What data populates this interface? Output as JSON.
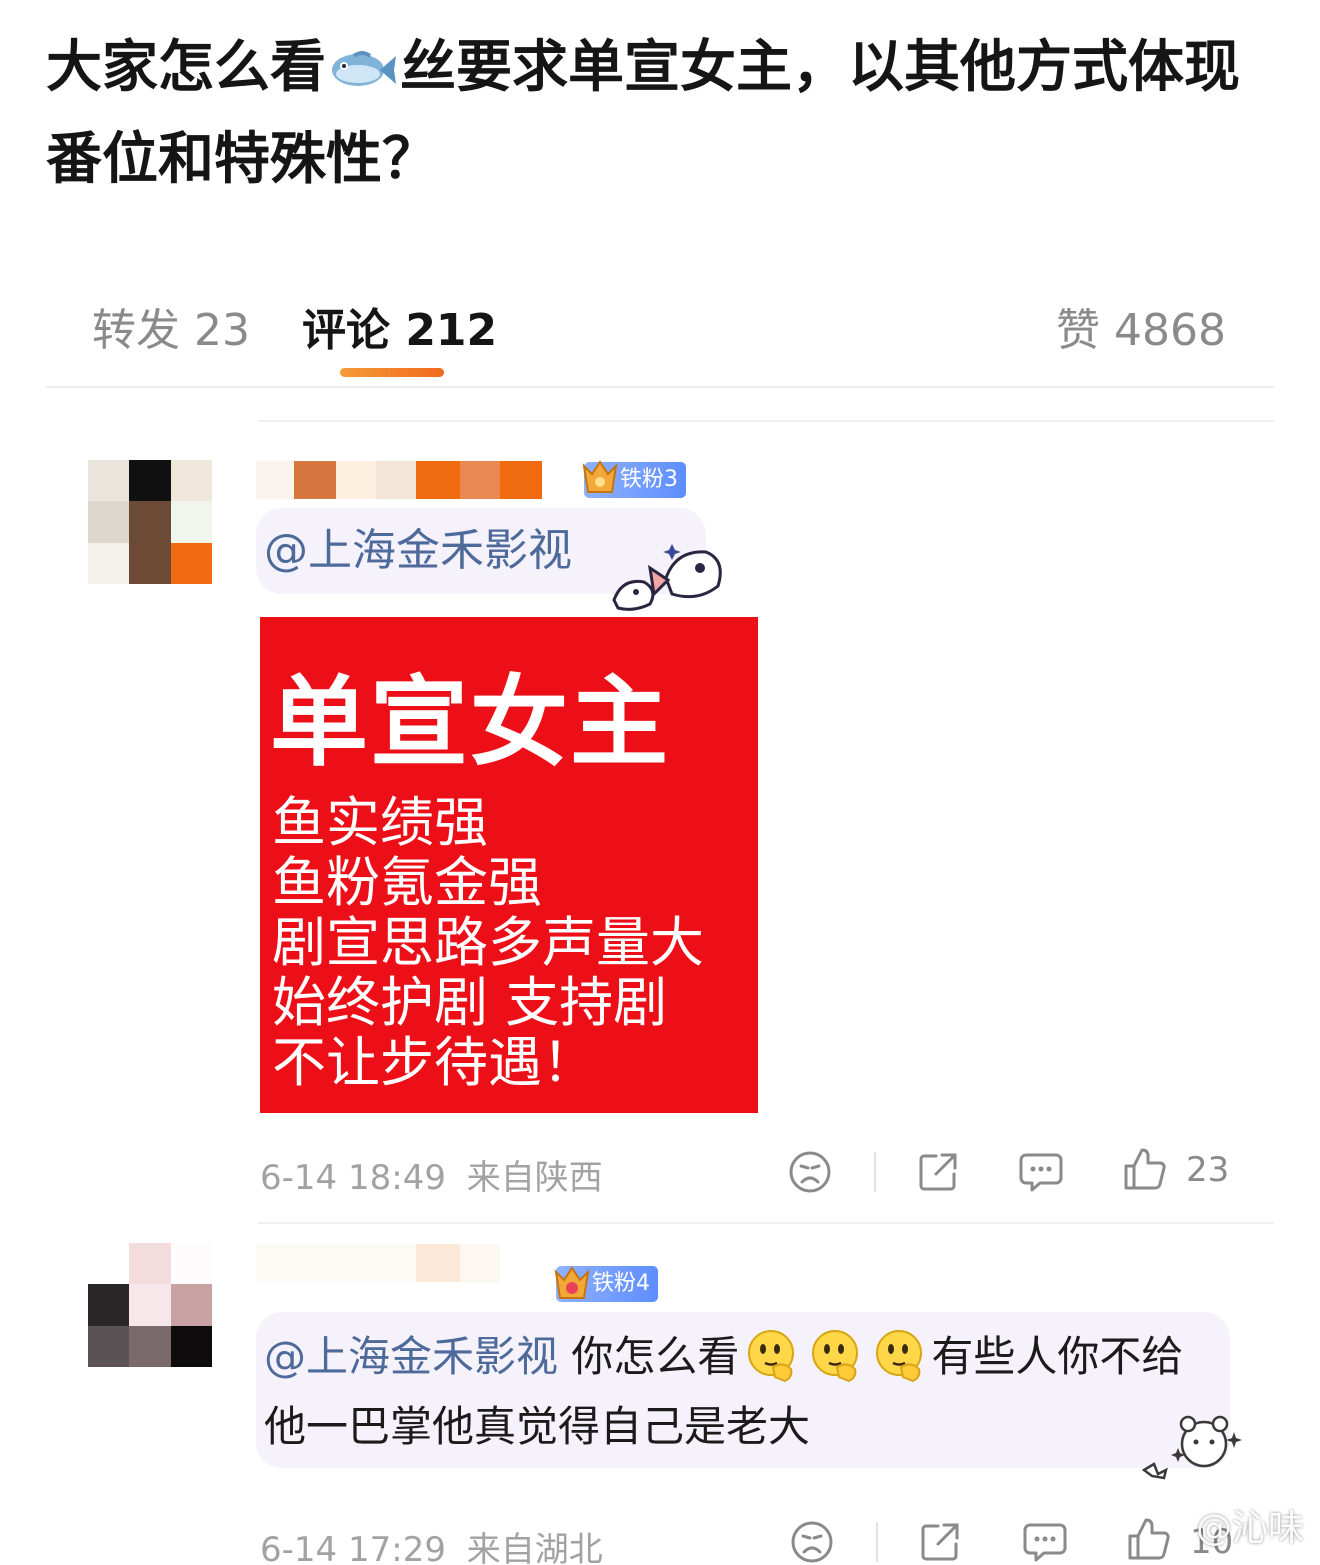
{
  "post": {
    "title_part1": "大家怎么看",
    "title_part2": "丝要求单宣女主，以其他方式体现番位和特殊性？"
  },
  "tabs": {
    "forward_label": "转发 23",
    "comments_label": "评论 212",
    "likes_label": "赞 4868"
  },
  "comments": [
    {
      "fan_badge": "铁粉3",
      "mention": "@上海金禾影视",
      "image": {
        "headline": "单宣女主",
        "lines": [
          "鱼实绩强",
          "鱼粉氪金强",
          "剧宣思路多声量大",
          "始终护剧 支持剧",
          "不让步待遇！"
        ]
      },
      "timestamp": "6-14 18:49",
      "location": "来自陕西",
      "like_count": "23"
    },
    {
      "fan_badge": "铁粉4",
      "mention": "@上海金禾影视",
      "text_part1": "你怎么看",
      "text_part2": "有些人你不给他一巴掌他真觉得自己是老大",
      "timestamp": "6-14 17:29",
      "location": "来自湖北",
      "like_count": "10"
    }
  ],
  "watermark": "@沁味",
  "colors": {
    "accent_orange": "#f07a2a",
    "promo_red": "#ed0f18",
    "mention_blue": "#4d6a9a"
  },
  "icons": [
    "fish-emoji",
    "fan-badge-icon",
    "dislike-icon",
    "share-icon",
    "comment-icon",
    "like-icon",
    "thinking-face-emoji"
  ]
}
